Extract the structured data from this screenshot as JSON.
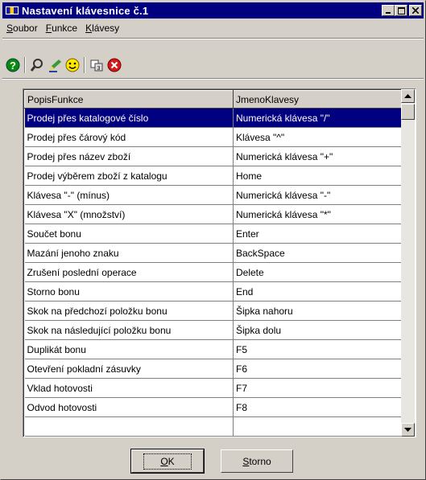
{
  "window": {
    "title": "Nastavení klávesnice č.1",
    "icon": "visa-card-icon",
    "controls": [
      "minimize",
      "maximize",
      "close"
    ]
  },
  "menu": {
    "items": [
      {
        "label": "Soubor",
        "accel": "S"
      },
      {
        "label": "Funkce",
        "accel": "F"
      },
      {
        "label": "Klávesy",
        "accel": "K"
      }
    ]
  },
  "toolbar": {
    "icons": [
      "help-icon",
      "find-icon",
      "edit-icon",
      "smiley-icon",
      "keyboard-icon",
      "delete-icon"
    ]
  },
  "grid": {
    "columns": [
      "PopisFunkce",
      "JmenoKlavesy"
    ],
    "selected_row": 0,
    "rows": [
      [
        "Prodej přes katalogové číslo",
        "Numerická klávesa \"/\""
      ],
      [
        "Prodej přes čárový kód",
        "Klávesa \"^\""
      ],
      [
        "Prodej přes název zboží",
        "Numerická klávesa \"+\""
      ],
      [
        "Prodej výběrem zboží z katalogu",
        "Home"
      ],
      [
        "Klávesa \"-\" (mínus)",
        "Numerická klávesa \"-\""
      ],
      [
        "Klávesa \"X\" (množství)",
        "Numerická klávesa \"*\""
      ],
      [
        "Součet bonu",
        "Enter"
      ],
      [
        "Mazání jenoho znaku",
        "BackSpace"
      ],
      [
        "Zrušení poslední operace",
        "Delete"
      ],
      [
        "Storno bonu",
        "End"
      ],
      [
        "Skok na předchozí položku bonu",
        "Šipka nahoru"
      ],
      [
        "Skok na následující položku bonu",
        "Šipka dolu"
      ],
      [
        "Duplikát bonu",
        "F5"
      ],
      [
        "Otevření pokladní zásuvky",
        "F6"
      ],
      [
        "Vklad hotovosti",
        "F7"
      ],
      [
        "Odvod hotovosti",
        "F8"
      ]
    ]
  },
  "buttons": {
    "ok": "OK",
    "cancel": "Storno"
  },
  "colors": {
    "titlebar": "#000080",
    "selection": "#000080",
    "face": "#d4d0c8"
  }
}
